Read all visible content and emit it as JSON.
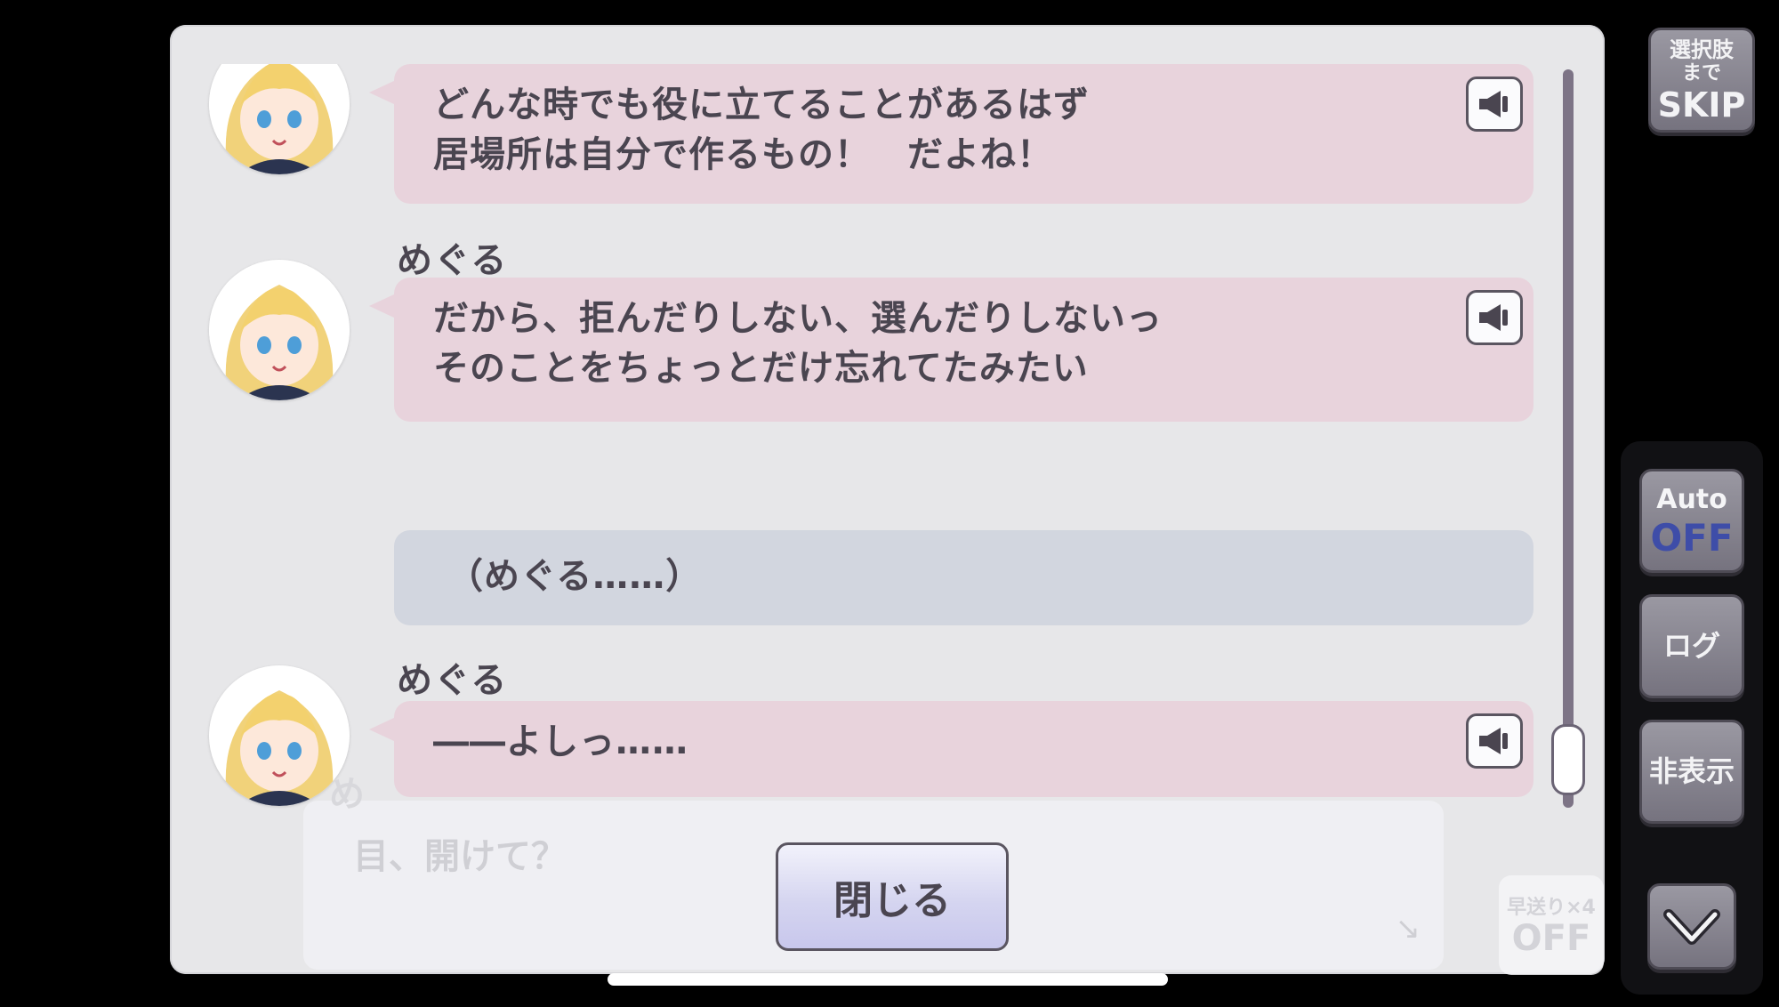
{
  "log": {
    "entries": [
      {
        "speaker": "",
        "text": "どんな時でも役に立てることがあるはず\n居場所は自分で作るもの！　だよね！",
        "type": "character",
        "has_voice": true
      },
      {
        "speaker": "めぐる",
        "text": "だから、拒んだりしない、選んだりしないっ\nそのことをちょっとだけ忘れてたみたい",
        "type": "character",
        "has_voice": true
      },
      {
        "speaker": "",
        "text": "（めぐる……）",
        "type": "narration",
        "has_voice": false
      },
      {
        "speaker": "めぐる",
        "text": "――よしっ……",
        "type": "character",
        "has_voice": true
      }
    ],
    "close_label": "閉じる",
    "scroll_position": 0.96
  },
  "background_dialog": {
    "partial_speaker": "め",
    "text": "目、開けて？",
    "fast_forward": {
      "label": "早送り×4",
      "state": "OFF"
    }
  },
  "controls": {
    "skip": {
      "line1": "選択肢",
      "line2": "まで",
      "line3": "SKIP"
    },
    "auto": {
      "label": "Auto",
      "state": "OFF"
    },
    "log_label": "ログ",
    "hide_label": "非表示",
    "down_icon": "chevron-down-icon"
  },
  "colors": {
    "character_bubble": "#e8d3dc",
    "narration_bubble": "#d2d6df",
    "panel": "#e7e7e9",
    "auto_off": "#3e4da8"
  }
}
